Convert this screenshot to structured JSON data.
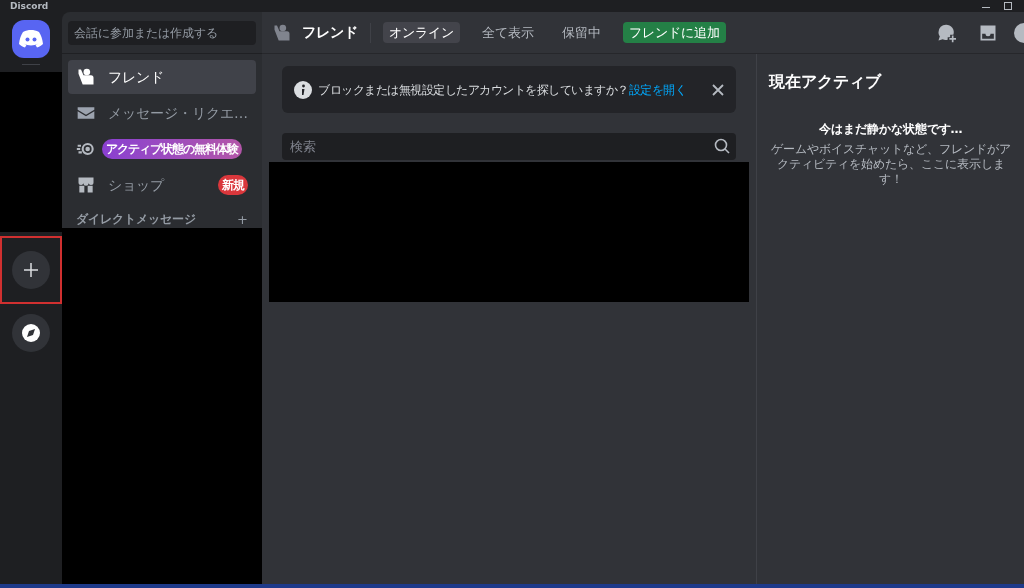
{
  "window": {
    "title": "Discord"
  },
  "server_rail": {
    "add_server_highlighted": true
  },
  "sidebar": {
    "search": {
      "placeholder": "会話に参加または作成する"
    },
    "items": [
      {
        "kind": "friends",
        "label": "フレンド",
        "selected": true
      },
      {
        "kind": "mail",
        "label": "メッセージ・リクエ…",
        "selected": false
      },
      {
        "kind": "nitro",
        "badge": "アクティブ状態の無料体験",
        "selected": false
      },
      {
        "kind": "shop",
        "label": "ショップ",
        "badge": "新規",
        "selected": false
      }
    ],
    "dm_header": {
      "label": "ダイレクトメッセージ",
      "add": "+"
    }
  },
  "header": {
    "title": "フレンド",
    "tabs": [
      {
        "label": "オンライン",
        "selected": true
      },
      {
        "label": "全て表示",
        "selected": false
      },
      {
        "label": "保留中",
        "selected": false
      }
    ],
    "add_friend": "フレンドに追加"
  },
  "notice": {
    "text": "ブロックまたは無視設定したアカウントを探していますか？",
    "link": "設定を開く"
  },
  "search": {
    "placeholder": "検索"
  },
  "active_now": {
    "title": "現在アクティブ",
    "empty_title": "今はまだ静かな状態です…",
    "empty_text": "ゲームやボイスチャットなど、フレンドがアクティビティを始めたら、ここに表示します！"
  }
}
